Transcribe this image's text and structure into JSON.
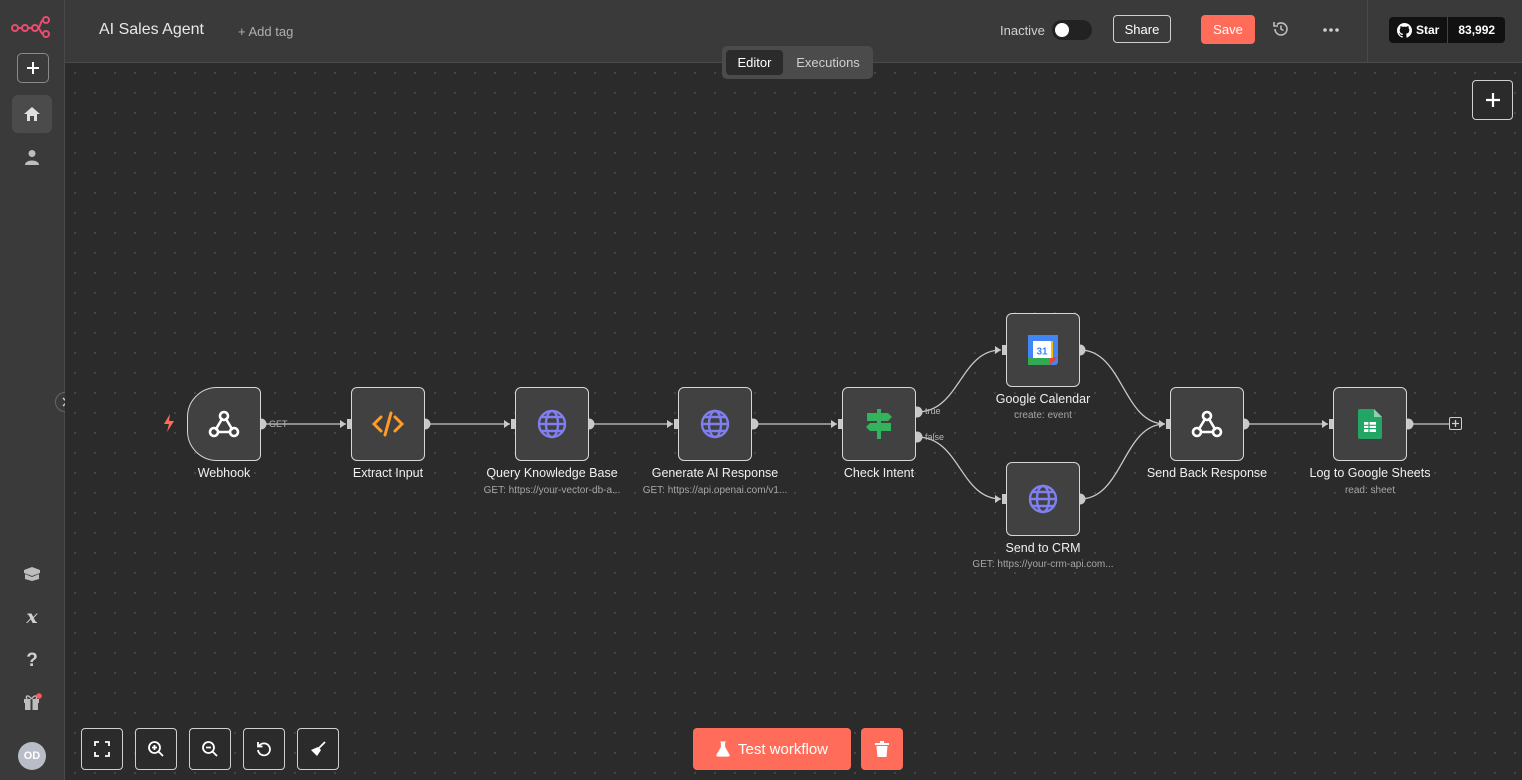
{
  "app": {
    "logo_icon": "n8n-logo-icon"
  },
  "header": {
    "title": "AI Sales Agent",
    "add_tag": "+ Add tag",
    "status_label": "Inactive",
    "active": false,
    "share_label": "Share",
    "save_label": "Save",
    "github_star_label": "Star",
    "github_star_count": "83,992"
  },
  "modes": {
    "editor": "Editor",
    "executions": "Executions",
    "selected": "Editor"
  },
  "sidebar": {
    "items": [
      {
        "name": "add",
        "icon": "plus-icon"
      },
      {
        "name": "home",
        "icon": "home-icon",
        "active": true
      },
      {
        "name": "user",
        "icon": "user-icon"
      },
      {
        "name": "templates",
        "icon": "box-icon"
      },
      {
        "name": "variables",
        "icon": "variable-icon"
      },
      {
        "name": "help",
        "icon": "question-icon"
      },
      {
        "name": "whats-new",
        "icon": "gift-icon"
      }
    ],
    "avatar_initials": "OD"
  },
  "workflow": {
    "nodes": [
      {
        "id": "webhook",
        "label": "Webhook",
        "subtitle": "",
        "icon": "webhook-icon",
        "trigger": true
      },
      {
        "id": "extract",
        "label": "Extract Input",
        "subtitle": "",
        "icon": "code-icon"
      },
      {
        "id": "kb",
        "label": "Query Knowledge Base",
        "subtitle": "GET: https://your-vector-db-a...",
        "icon": "globe-icon"
      },
      {
        "id": "ai",
        "label": "Generate AI Response",
        "subtitle": "GET: https://api.openai.com/v1...",
        "icon": "globe-icon"
      },
      {
        "id": "intent",
        "label": "Check Intent",
        "subtitle": "",
        "icon": "signpost-icon"
      },
      {
        "id": "gcal",
        "label": "Google Calendar",
        "subtitle": "create: event",
        "icon": "google-calendar-icon"
      },
      {
        "id": "crm",
        "label": "Send to CRM",
        "subtitle": "GET: https://your-crm-api.com...",
        "icon": "globe-icon"
      },
      {
        "id": "respond",
        "label": "Send Back Response",
        "subtitle": "",
        "icon": "webhook-icon"
      },
      {
        "id": "sheets",
        "label": "Log to Google Sheets",
        "subtitle": "read: sheet",
        "icon": "google-sheets-icon"
      }
    ],
    "edge_labels": {
      "webhook_method": "GET",
      "branch_true": "true",
      "branch_false": "false"
    },
    "calendar_day": "31"
  },
  "footer": {
    "test_label": "Test workflow"
  },
  "colors": {
    "accent": "#ff6d5a",
    "canvas": "#2b2b2b",
    "node_bg": "#414141",
    "globe": "#7f7ff0",
    "code": "#ff9b26",
    "if": "#35b35c"
  }
}
